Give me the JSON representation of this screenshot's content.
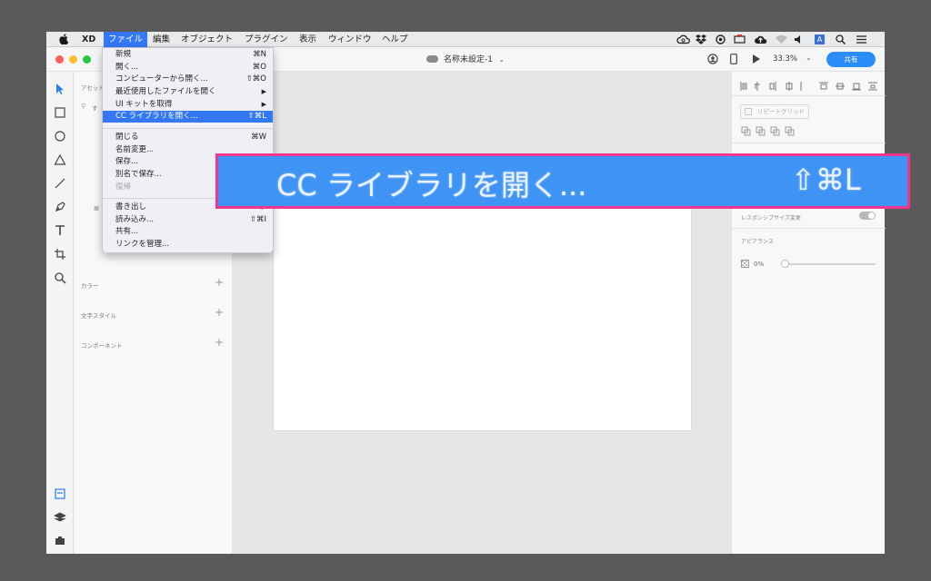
{
  "menubar": {
    "app_name": "XD",
    "items": [
      "ファイル",
      "編集",
      "オブジェクト",
      "プラグイン",
      "表示",
      "ウィンドウ",
      "ヘルプ"
    ],
    "active_index": 0,
    "status_icons": [
      "creative-cloud-icon",
      "dropbox-icon",
      "sync-icon",
      "cast-icon",
      "upload-icon",
      "wifi-icon",
      "volume-icon",
      "input-source-icon",
      "search-icon",
      "menu-list-icon"
    ],
    "input_source_label": "A"
  },
  "window": {
    "doc_title": "名称未設定-1",
    "zoom": "33.3%",
    "share_label": "共有"
  },
  "file_menu": {
    "groups": [
      [
        {
          "label": "新規",
          "shortcut": "⌘N"
        },
        {
          "label": "開く...",
          "shortcut": "⌘O"
        },
        {
          "label": "コンピューターから開く...",
          "shortcut": "⇧⌘O"
        },
        {
          "label": "最近使用したファイルを開く",
          "shortcut": "▶"
        },
        {
          "label": "UI キットを取得",
          "shortcut": "▶"
        },
        {
          "label": "CC ライブラリを開く...",
          "shortcut": "⇧⌘L",
          "selected": true
        }
      ],
      [
        {
          "label": "閉じる",
          "shortcut": "⌘W"
        },
        {
          "label": "名前変更...",
          "shortcut": ""
        },
        {
          "label": "保存...",
          "shortcut": ""
        },
        {
          "label": "別名で保存...",
          "shortcut": ""
        },
        {
          "label": "復帰",
          "shortcut": "",
          "disabled": true
        }
      ],
      [
        {
          "label": "書き出し",
          "shortcut": "▶"
        },
        {
          "label": "読み込み...",
          "shortcut": "⇧⌘I"
        },
        {
          "label": "共有...",
          "shortcut": ""
        },
        {
          "label": "リンクを管理...",
          "shortcut": ""
        }
      ]
    ]
  },
  "left_panel": {
    "header": "アセット",
    "search_placeholder": "す",
    "sections": [
      "カラー",
      "文字スタイル",
      "コンポーネント"
    ]
  },
  "right_panel": {
    "repeat_grid_label": "リピートグリッド",
    "responsive_resize_label": "レスポンシブサイズ変更",
    "appearance_label": "アピアランス",
    "opacity_value": "0%"
  },
  "zoom_callout": {
    "label": "CC ライブラリを開く...",
    "shortcut": "⇧⌘L"
  },
  "colors": {
    "accent": "#3478f6",
    "share_button": "#2b8ef8",
    "callout_border": "#f0368f"
  }
}
